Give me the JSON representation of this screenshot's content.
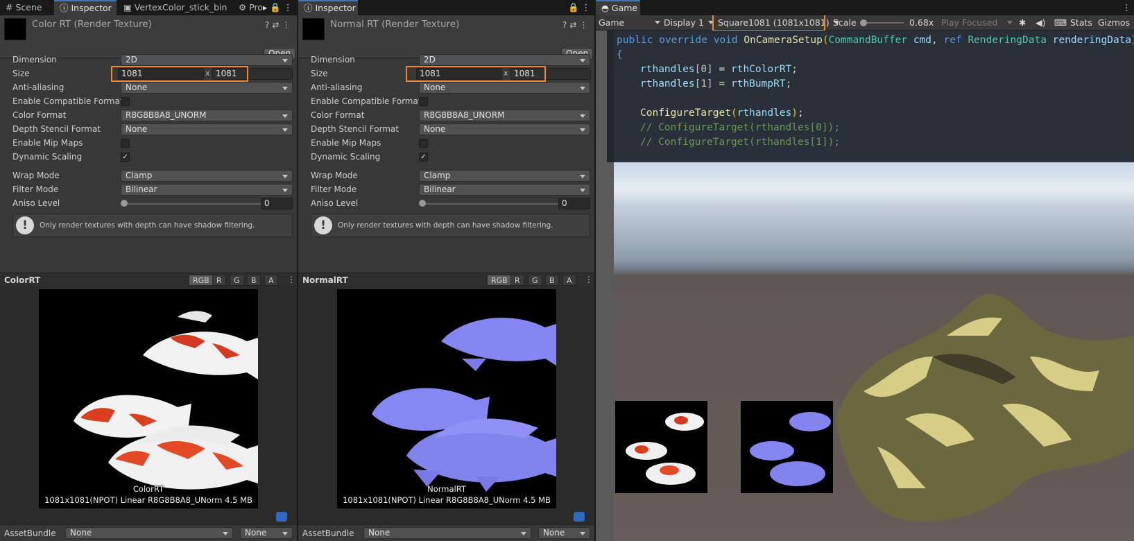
{
  "tabs": {
    "left": [
      {
        "label": "Scene",
        "icon": "grid-icon"
      },
      {
        "label": "Inspector",
        "icon": "info-icon"
      },
      {
        "label": "VertexColor_stick_bin",
        "icon": "asset-icon"
      },
      {
        "label": "Pro",
        "icon": "gear-icon"
      }
    ],
    "middle": {
      "label": "Inspector",
      "icon": "info-icon"
    },
    "game": {
      "label": "Game",
      "icon": "gamepad-icon"
    }
  },
  "inspectors": [
    {
      "title": "Color RT (Render Texture)",
      "open_label": "Open",
      "props": {
        "dimension_label": "Dimension",
        "dimension": "2D",
        "size_label": "Size",
        "width": "1081",
        "x": "x",
        "height": "1081",
        "aa_label": "Anti-aliasing",
        "aa": "None",
        "compat_label": "Enable Compatible Format",
        "color_format_label": "Color Format",
        "color_format": "R8G8B8A8_UNORM",
        "depth_label": "Depth Stencil Format",
        "depth": "None",
        "mip_label": "Enable Mip Maps",
        "dyn_label": "Dynamic Scaling",
        "dyn_check": "✓",
        "wrap_label": "Wrap Mode",
        "wrap": "Clamp",
        "filter_label": "Filter Mode",
        "filter": "Bilinear",
        "aniso_label": "Aniso Level",
        "aniso": "0"
      },
      "info": "Only render textures with depth can have shadow filtering.",
      "preview": {
        "label": "ColorRT",
        "channels": [
          "RGB",
          "R",
          "G",
          "B",
          "A"
        ],
        "name": "ColorRT",
        "stats": "1081x1081(NPOT) Linear  R8G8B8A8_UNorm  4.5 MB"
      },
      "assetbundle": {
        "label": "AssetBundle",
        "name": "None",
        "variant": "None"
      }
    },
    {
      "title": "Normal RT (Render Texture)",
      "open_label": "Open",
      "props": {
        "dimension_label": "Dimension",
        "dimension": "2D",
        "size_label": "Size",
        "width": "1081",
        "x": "x",
        "height": "1081",
        "aa_label": "Anti-aliasing",
        "aa": "None",
        "compat_label": "Enable Compatible Format",
        "color_format_label": "Color Format",
        "color_format": "R8G8B8A8_UNORM",
        "depth_label": "Depth Stencil Format",
        "depth": "None",
        "mip_label": "Enable Mip Maps",
        "dyn_label": "Dynamic Scaling",
        "dyn_check": "✓",
        "wrap_label": "Wrap Mode",
        "wrap": "Clamp",
        "filter_label": "Filter Mode",
        "filter": "Bilinear",
        "aniso_label": "Aniso Level",
        "aniso": "0"
      },
      "info": "Only render textures with depth can have shadow filtering.",
      "preview": {
        "label": "NormalRT",
        "channels": [
          "RGB",
          "R",
          "G",
          "B",
          "A"
        ],
        "name": "NormalRT",
        "stats": "1081x1081(NPOT) Linear  R8G8B8A8_UNorm  4.5 MB"
      },
      "assetbundle": {
        "label": "AssetBundle",
        "name": "None",
        "variant": "None"
      }
    }
  ],
  "game": {
    "mode": "Game",
    "display": "Display 1",
    "resolution": "Square1081 (1081x1081)",
    "scale_label": "Scale",
    "scale_value": "0.68x",
    "play_mode": "Play Focused",
    "stats": "Stats",
    "gizmos": "Gizmos"
  },
  "code": {
    "line1": {
      "kw1": "public",
      "kw2": "override",
      "kw3": "void",
      "fn": "OnCameraSetup",
      "open": "(",
      "t1": "CommandBuffer",
      "p1": "cmd",
      "comma": ", ",
      "kw4": "ref",
      "t2": "RenderingData",
      "p2": "renderingData",
      "close": ")"
    },
    "line2": "{",
    "line3": {
      "var": "rthandles",
      "ob": "[",
      "idx": "0",
      "cb": "]",
      "eq": " = ",
      "val": "rthColorRT",
      "semi": ";"
    },
    "line4": {
      "var": "rthandles",
      "ob": "[",
      "idx": "1",
      "cb": "]",
      "eq": " = ",
      "val": "rthBumpRT",
      "semi": ";"
    },
    "line5": {
      "fn": "ConfigureTarget",
      "open": "(",
      "arg": "rthandles",
      "close": ")",
      "semi": ";"
    },
    "line6": "// ConfigureTarget(rthandles[0]);",
    "line7": "// ConfigureTarget(rthandles[1]);"
  },
  "colors": {
    "highlight": "#f0862e",
    "accent": "#3a79bb",
    "normal_fish": "#8484f2"
  }
}
